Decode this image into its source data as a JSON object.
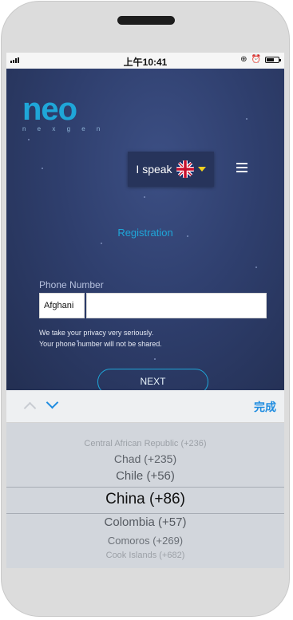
{
  "status_bar": {
    "time": "上午10:41",
    "icons": [
      "signal-icon",
      "alarm-icon",
      "clock-icon",
      "battery-icon"
    ]
  },
  "header": {
    "logo_word": "neo",
    "logo_sub": "n e x g e n",
    "language_label": "I speak",
    "language_flag": "uk-flag-icon",
    "menu_icon": "hamburger-icon"
  },
  "form": {
    "title": "Registration",
    "phone_label": "Phone Number",
    "country_code_value": "Afghani",
    "phone_value": "",
    "privacy_line1": "We take your privacy very seriously.",
    "privacy_line2": "Your phone number will not be shared.",
    "next_label": "NEXT"
  },
  "picker_toolbar": {
    "done_label": "完成"
  },
  "picker": {
    "items": [
      "Central African Republic (+236)",
      "Chad (+235)",
      "Chile (+56)",
      "China (+86)",
      "Colombia (+57)",
      "Comoros (+269)",
      "Cook Islands (+682)"
    ],
    "selected": "China (+86)"
  },
  "colors": {
    "accent": "#1fa6d8",
    "app_bg": "#2f3f6e",
    "picker_bg": "#d2d6dc",
    "done": "#1f8ce0"
  }
}
